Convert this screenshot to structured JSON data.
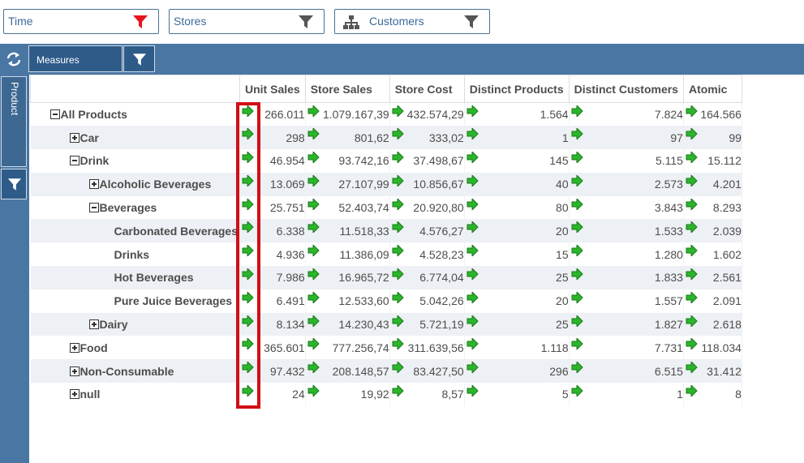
{
  "filters": [
    {
      "label": "Time",
      "icon": "funnel-icon",
      "active": true,
      "color": "#e8141b"
    },
    {
      "label": "Stores",
      "icon": "funnel-icon",
      "active": false,
      "color": "#555555"
    },
    {
      "label": "Customers",
      "icon": "hierarchy-icon",
      "active": false,
      "color": "#555555"
    }
  ],
  "toolbar": {
    "measures_label": "Measures",
    "swap_icon": "swap-axes-icon",
    "filter_icon": "funnel-icon"
  },
  "leftbar": {
    "dimension_label": "Product",
    "filter_icon": "funnel-icon"
  },
  "grid": {
    "columns": [
      "Unit Sales",
      "Store Sales",
      "Store Cost",
      "Distinct Products",
      "Distinct Customers",
      "Atomic"
    ],
    "rows": [
      {
        "label": "All Products",
        "level": 0,
        "expander": "minus",
        "values": [
          "266.011",
          "1.079.167,39",
          "432.574,29",
          "1.564",
          "7.824",
          "164.566"
        ]
      },
      {
        "label": "Car",
        "level": 1,
        "expander": "plus",
        "values": [
          "298",
          "801,62",
          "333,02",
          "1",
          "97",
          "99"
        ]
      },
      {
        "label": "Drink",
        "level": 1,
        "expander": "minus",
        "values": [
          "46.954",
          "93.742,16",
          "37.498,67",
          "145",
          "5.115",
          "15.112"
        ]
      },
      {
        "label": "Alcoholic Beverages",
        "level": 2,
        "expander": "plus",
        "values": [
          "13.069",
          "27.107,99",
          "10.856,67",
          "40",
          "2.573",
          "4.201"
        ]
      },
      {
        "label": "Beverages",
        "level": 2,
        "expander": "minus",
        "values": [
          "25.751",
          "52.403,74",
          "20.920,80",
          "80",
          "3.843",
          "8.293"
        ]
      },
      {
        "label": "Carbonated Beverages",
        "level": 3,
        "expander": "none",
        "values": [
          "6.338",
          "11.518,33",
          "4.576,27",
          "20",
          "1.533",
          "2.039"
        ]
      },
      {
        "label": "Drinks",
        "level": 3,
        "expander": "none",
        "values": [
          "4.936",
          "11.386,09",
          "4.528,23",
          "15",
          "1.280",
          "1.602"
        ]
      },
      {
        "label": "Hot Beverages",
        "level": 3,
        "expander": "none",
        "values": [
          "7.986",
          "16.965,72",
          "6.774,04",
          "25",
          "1.833",
          "2.561"
        ]
      },
      {
        "label": "Pure Juice Beverages",
        "level": 3,
        "expander": "none",
        "values": [
          "6.491",
          "12.533,60",
          "5.042,26",
          "20",
          "1.557",
          "2.091"
        ]
      },
      {
        "label": "Dairy",
        "level": 2,
        "expander": "plus",
        "values": [
          "8.134",
          "14.230,43",
          "5.721,19",
          "25",
          "1.827",
          "2.618"
        ]
      },
      {
        "label": "Food",
        "level": 1,
        "expander": "plus",
        "values": [
          "365.601",
          "777.256,74",
          "311.639,56",
          "1.118",
          "7.731",
          "118.034"
        ]
      },
      {
        "label": "Non-Consumable",
        "level": 1,
        "expander": "plus",
        "values": [
          "97.432",
          "208.148,57",
          "83.427,50",
          "296",
          "6.515",
          "31.412"
        ]
      },
      {
        "label": "null",
        "level": 1,
        "expander": "plus",
        "values": [
          "24",
          "19,92",
          "8,57",
          "5",
          "1",
          "8"
        ]
      }
    ],
    "cell_icon": "drillthrough-arrow-icon",
    "highlight_color": "#d10f15"
  }
}
